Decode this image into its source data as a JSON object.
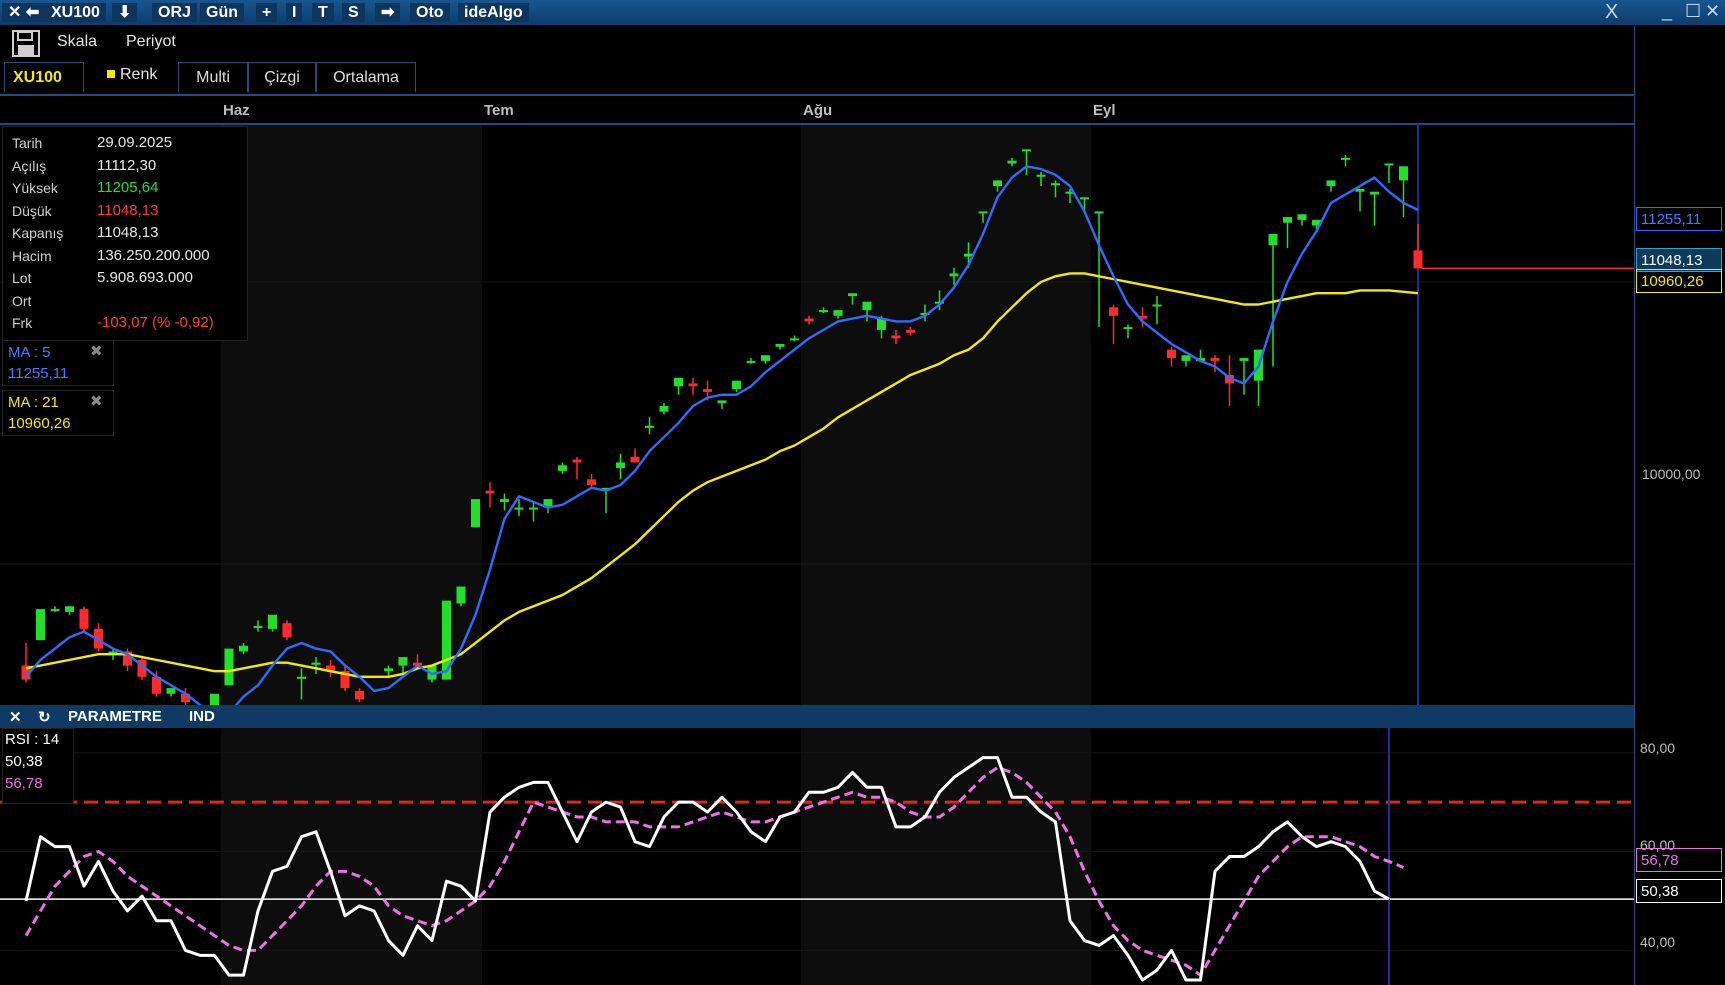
{
  "titlebar": {
    "close_arrow": "✕ ⬅",
    "symbol": "XU100",
    "download": "⬇",
    "orj": "ORJ",
    "period": "Gün",
    "plus": "+",
    "i": "I",
    "t": "T",
    "s": "S",
    "arrow": "➡",
    "oto": "Oto",
    "idealgo": "ideAlgo",
    "x_logo": "X",
    "minimize": "_",
    "maximize": "☐",
    "close": "✕"
  },
  "toolbar": {
    "skala": "Skala",
    "periyot": "Periyot"
  },
  "tabs": {
    "symbol": "XU100",
    "renk": "Renk",
    "multi": "Multi",
    "cizgi": "Çizgi",
    "ortalama": "Ortalama"
  },
  "colors": {
    "up": "#22e02a",
    "down": "#ff2b2b",
    "ma5": "#2c6cff",
    "ma21": "#f2ea07",
    "rsi": "#ffffff",
    "rsi_ma": "#ee6fe6",
    "level": "#e8221d"
  },
  "info": {
    "labels": [
      "Tarih",
      "Açılış",
      "Yüksek",
      "Düşük",
      "Kapanış",
      "Hacim",
      "Lot",
      "Ort",
      "Frk"
    ],
    "date": "29.09.2025",
    "open": "11112,30",
    "high": "11205,64",
    "low": "11048,13",
    "close": "11048,13",
    "volume": "136.250.200.000",
    "lot": "5.908.693.000",
    "avg": "",
    "change": "-103,07 (% -0,92)"
  },
  "ma5": {
    "label": "MA : 5",
    "value": "11255,11",
    "close_icon": "✖"
  },
  "ma21": {
    "label": "MA : 21",
    "value": "10960,26",
    "close_icon": "✖"
  },
  "price_tags": {
    "ma5": "11255,11",
    "last": "11048,13",
    "ma21": "10960,26"
  },
  "axis": {
    "price_label": "10000,00",
    "rsi_80": "80,00",
    "rsi_60": "60,00",
    "rsi_40": "40,00"
  },
  "rsi_panel": {
    "bar_close": "✕",
    "bar_refresh": "↻",
    "parametre": "PARAMETRE",
    "ind": "IND",
    "label": "RSI : 14",
    "value": "50,38",
    "ma_value": "56,78",
    "tag_rsi": "50,38",
    "tag_ma": "56,78"
  },
  "chart_data": [
    {
      "type": "candlestick",
      "x_labels": [
        "Haz",
        "Tem",
        "Ağu",
        "Eyl"
      ],
      "month_start_index": [
        14,
        32,
        54,
        74
      ],
      "y_tick": 10000,
      "ylim": [
        9500,
        11560
      ],
      "candles": [
        [
          9640,
          9720,
          9590,
          9580
        ],
        [
          9730,
          9840,
          9840,
          9730
        ],
        [
          9840,
          9850,
          9840,
          9830
        ],
        [
          9830,
          9850,
          9850,
          9820
        ],
        [
          9840,
          9850,
          9770,
          9760
        ],
        [
          9770,
          9790,
          9700,
          9690
        ],
        [
          9680,
          9700,
          9690,
          9660
        ],
        [
          9690,
          9700,
          9640,
          9620
        ],
        [
          9660,
          9670,
          9600,
          9590
        ],
        [
          9600,
          9620,
          9540,
          9530
        ],
        [
          9540,
          9550,
          9560,
          9530
        ],
        [
          9540,
          9560,
          9510,
          9480
        ],
        [
          9460,
          9470,
          9440,
          9430
        ],
        [
          9450,
          9450,
          9540,
          9440
        ],
        [
          9570,
          9570,
          9700,
          9570
        ],
        [
          9690,
          9720,
          9710,
          9680
        ],
        [
          9780,
          9800,
          9780,
          9760
        ],
        [
          9770,
          9800,
          9820,
          9760
        ],
        [
          9790,
          9800,
          9740,
          9730
        ],
        [
          9600,
          9630,
          9600,
          9520
        ],
        [
          9650,
          9670,
          9650,
          9610
        ],
        [
          9640,
          9660,
          9620,
          9600
        ],
        [
          9620,
          9640,
          9560,
          9550
        ],
        [
          9550,
          9560,
          9520,
          9510
        ],
        [
          9490,
          9500,
          9500,
          9470
        ],
        [
          9620,
          9640,
          9630,
          9600
        ],
        [
          9640,
          9660,
          9670,
          9610
        ],
        [
          9650,
          9680,
          9640,
          9630
        ],
        [
          9590,
          9600,
          9640,
          9580
        ],
        [
          9590,
          9640,
          9870,
          9590
        ],
        [
          9860,
          9870,
          9920,
          9850
        ],
        [
          10130,
          10190,
          10230,
          10130
        ],
        [
          10260,
          10290,
          10250,
          10200
        ],
        [
          10220,
          10250,
          10230,
          10190
        ],
        [
          10200,
          10230,
          10200,
          10170
        ],
        [
          10200,
          10220,
          10200,
          10150
        ],
        [
          10200,
          10220,
          10230,
          10180
        ],
        [
          10330,
          10360,
          10350,
          10320
        ],
        [
          10370,
          10380,
          10360,
          10300
        ],
        [
          10300,
          10320,
          10280,
          10270
        ],
        [
          10260,
          10270,
          10270,
          10180
        ],
        [
          10340,
          10390,
          10360,
          10300
        ],
        [
          10380,
          10410,
          10360,
          10370
        ],
        [
          10490,
          10520,
          10490,
          10460
        ],
        [
          10540,
          10570,
          10560,
          10530
        ],
        [
          10630,
          10660,
          10660,
          10600
        ],
        [
          10640,
          10660,
          10630,
          10600
        ],
        [
          10620,
          10650,
          10610,
          10580
        ],
        [
          10570,
          10580,
          10580,
          10550
        ],
        [
          10620,
          10620,
          10650,
          10610
        ],
        [
          10720,
          10730,
          10720,
          10710
        ],
        [
          10720,
          10740,
          10740,
          10710
        ],
        [
          10770,
          10780,
          10780,
          10760
        ],
        [
          10800,
          10810,
          10800,
          10790
        ],
        [
          10870,
          10880,
          10860,
          10850
        ],
        [
          10900,
          10910,
          10900,
          10890
        ],
        [
          10880,
          10880,
          10900,
          10870
        ],
        [
          10950,
          10950,
          10960,
          10920
        ],
        [
          10900,
          10900,
          10930,
          10860
        ],
        [
          10830,
          10880,
          10870,
          10800
        ],
        [
          10810,
          10830,
          10800,
          10780
        ],
        [
          10830,
          10840,
          10820,
          10810
        ],
        [
          10890,
          10920,
          10890,
          10860
        ],
        [
          10930,
          10970,
          10930,
          10900
        ],
        [
          11020,
          11050,
          11030,
          10990
        ],
        [
          11090,
          11140,
          11100,
          11050
        ],
        [
          11250,
          11250,
          11250,
          11210
        ],
        [
          11340,
          11360,
          11360,
          11320
        ],
        [
          11420,
          11440,
          11430,
          11410
        ],
        [
          11470,
          11470,
          11470,
          11380
        ],
        [
          11380,
          11390,
          11380,
          11340
        ],
        [
          11350,
          11360,
          11350,
          11300
        ],
        [
          11320,
          11330,
          11320,
          11280
        ],
        [
          11300,
          11300,
          11300,
          11250
        ],
        [
          11250,
          11250,
          11250,
          10840
        ],
        [
          10910,
          10920,
          10880,
          10780
        ],
        [
          10840,
          10850,
          10840,
          10800
        ],
        [
          10880,
          10910,
          10870,
          10840
        ],
        [
          10920,
          10950,
          10920,
          10850
        ],
        [
          10760,
          10770,
          10730,
          10700
        ],
        [
          10720,
          10730,
          10740,
          10700
        ],
        [
          10720,
          10760,
          10730,
          10720
        ],
        [
          10730,
          10740,
          10720,
          10680
        ],
        [
          10670,
          10740,
          10640,
          10560
        ],
        [
          10720,
          10720,
          10730,
          10600
        ],
        [
          10650,
          10700,
          10760,
          10560
        ],
        [
          11130,
          11130,
          11170,
          10700
        ],
        [
          11210,
          11220,
          11230,
          11120
        ],
        [
          11220,
          11230,
          11240,
          11200
        ],
        [
          11200,
          11220,
          11220,
          11180
        ],
        [
          11340,
          11350,
          11360,
          11320
        ],
        [
          11440,
          11450,
          11440,
          11410
        ],
        [
          11320,
          11320,
          11330,
          11250
        ],
        [
          11310,
          11310,
          11320,
          11200
        ],
        [
          11420,
          11420,
          11420,
          11350
        ],
        [
          11360,
          11360,
          11410,
          11230
        ],
        [
          11112,
          11206,
          11048,
          11048
        ]
      ],
      "ma5": [
        9600,
        9660,
        9700,
        9740,
        9760,
        9730,
        9700,
        9680,
        9640,
        9600,
        9570,
        9540,
        9500,
        9460,
        9470,
        9530,
        9570,
        9640,
        9700,
        9720,
        9700,
        9690,
        9640,
        9600,
        9550,
        9560,
        9600,
        9640,
        9610,
        9620,
        9700,
        9820,
        9980,
        10160,
        10240,
        10220,
        10200,
        10210,
        10240,
        10270,
        10260,
        10280,
        10330,
        10400,
        10450,
        10500,
        10560,
        10590,
        10600,
        10600,
        10630,
        10680,
        10720,
        10760,
        10800,
        10830,
        10860,
        10870,
        10880,
        10870,
        10860,
        10860,
        10880,
        10920,
        10980,
        11060,
        11170,
        11300,
        11370,
        11410,
        11400,
        11380,
        11340,
        11250,
        11130,
        11020,
        10920,
        10860,
        10820,
        10780,
        10750,
        10720,
        10700,
        10660,
        10640,
        10700,
        10860,
        11000,
        11100,
        11180,
        11280,
        11310,
        11340,
        11370,
        11320,
        11280,
        11255.11
      ],
      "ma21": [
        9630,
        9640,
        9650,
        9660,
        9670,
        9680,
        9680,
        9680,
        9670,
        9660,
        9650,
        9640,
        9630,
        9620,
        9620,
        9630,
        9640,
        9650,
        9650,
        9640,
        9630,
        9620,
        9610,
        9600,
        9600,
        9600,
        9610,
        9630,
        9640,
        9660,
        9680,
        9720,
        9760,
        9800,
        9830,
        9850,
        9870,
        9890,
        9920,
        9950,
        9990,
        10030,
        10070,
        10120,
        10170,
        10220,
        10260,
        10290,
        10310,
        10330,
        10350,
        10370,
        10400,
        10420,
        10450,
        10480,
        10520,
        10550,
        10580,
        10610,
        10640,
        10670,
        10690,
        10710,
        10740,
        10760,
        10800,
        10860,
        10910,
        10960,
        11000,
        11020,
        11030,
        11030,
        11020,
        11010,
        11000,
        10990,
        10980,
        10970,
        10960,
        10950,
        10940,
        10930,
        10920,
        10920,
        10930,
        10940,
        10950,
        10960,
        10960,
        10960,
        10970,
        10970,
        10970,
        10965,
        10960.26
      ]
    },
    {
      "type": "line",
      "name": "RSI : 14",
      "ylim": [
        33,
        85
      ],
      "levels": [
        70,
        50.38
      ],
      "y_ticks": [
        80,
        60,
        40
      ],
      "rsi": [
        50,
        63,
        61,
        61,
        53,
        58,
        52,
        48,
        51,
        46,
        46,
        40,
        39,
        39,
        35,
        35,
        48,
        56,
        57,
        63,
        64,
        56,
        47,
        49,
        48,
        42,
        39,
        45,
        42,
        54,
        53,
        50,
        68,
        71,
        73,
        74,
        74,
        68,
        62,
        68,
        70,
        69,
        62,
        61,
        67,
        70,
        70,
        68,
        71,
        68,
        64,
        62,
        67,
        68,
        72,
        72,
        73,
        76,
        73,
        73,
        65,
        65,
        67,
        72,
        75,
        77,
        79,
        79,
        71,
        71,
        68,
        66,
        46,
        42,
        41,
        43,
        39,
        34,
        36,
        40,
        34,
        34,
        56,
        59,
        59,
        61,
        64,
        66,
        63,
        61,
        62,
        61,
        58,
        52,
        50.38
      ],
      "rsi_ma": [
        43,
        48,
        53,
        56,
        59,
        60,
        58,
        55,
        53,
        51,
        49,
        47,
        45,
        43,
        41,
        40,
        40,
        43,
        46,
        49,
        53,
        56,
        56,
        55,
        53,
        49,
        47,
        46,
        45,
        46,
        48,
        50,
        53,
        58,
        64,
        70,
        69,
        68,
        67,
        67,
        66,
        66,
        66,
        65,
        65,
        65,
        66,
        67,
        68,
        67,
        66,
        66,
        67,
        68,
        69,
        70,
        71,
        72,
        71,
        71,
        70,
        68,
        67,
        67,
        69,
        72,
        75,
        77,
        76,
        74,
        71,
        68,
        63,
        56,
        50,
        45,
        42,
        40,
        39,
        38,
        37,
        35,
        40,
        45,
        50,
        55,
        58,
        61,
        63,
        63,
        63,
        62,
        61,
        59,
        58,
        56.78
      ]
    }
  ]
}
